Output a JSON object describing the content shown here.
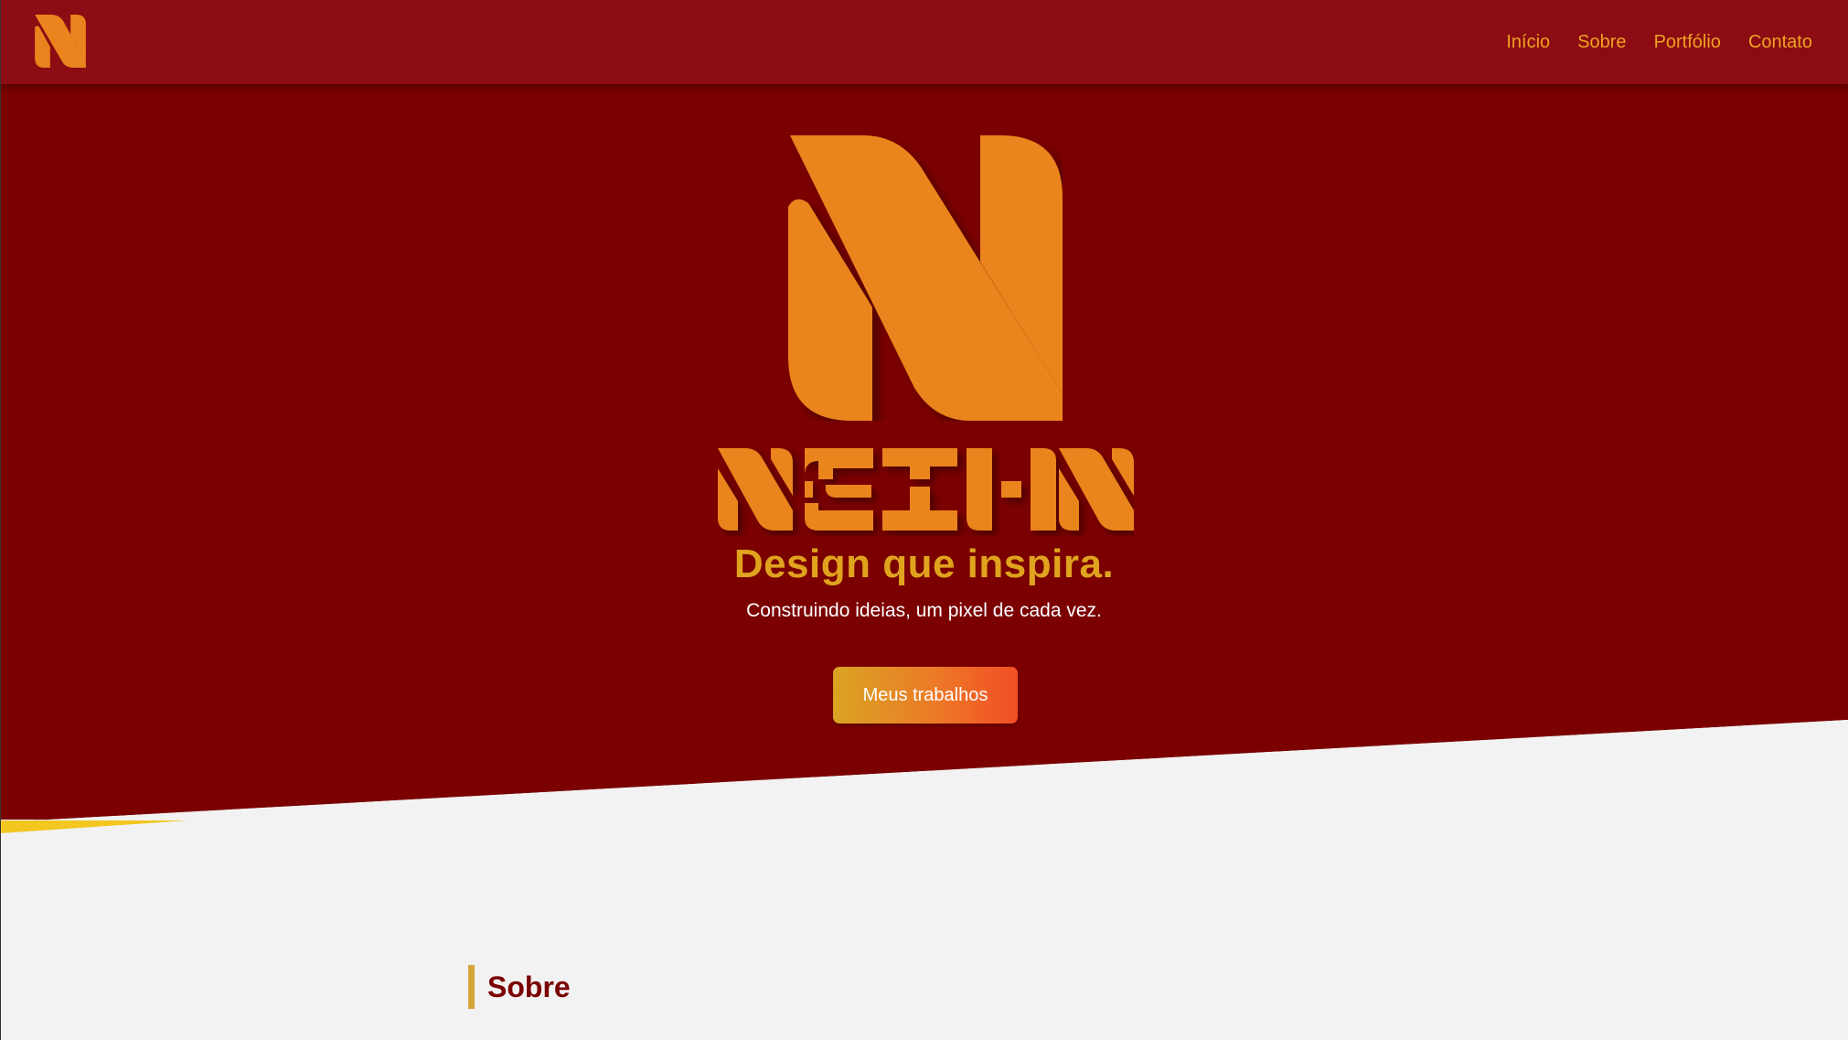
{
  "app": {
    "name": "NEIHN"
  },
  "navbar": {
    "logo_icon": "n-logo-icon",
    "links": [
      {
        "label": "Início"
      },
      {
        "label": "Sobre"
      },
      {
        "label": "Portfólio"
      },
      {
        "label": "Contato"
      }
    ]
  },
  "hero": {
    "logo_icon": "n-logo-mark",
    "wordmark": "NEIHN",
    "tagline": "Design que inspira.",
    "subtitle": "Construindo ideias, um pixel de cada vez.",
    "cta_label": "Meus trabalhos"
  },
  "sobre": {
    "title": "Sobre"
  },
  "colors": {
    "navbar_bg": "#8b0c13",
    "hero_bg": "#7b0000",
    "logo_orange": "#ea841e",
    "accent_gold": "#e0a31e",
    "page_bg": "#f2f2f2",
    "slant_yellow": "#f3c620",
    "cta_gradient_start": "#d9a423",
    "cta_gradient_end": "#f24e25"
  }
}
